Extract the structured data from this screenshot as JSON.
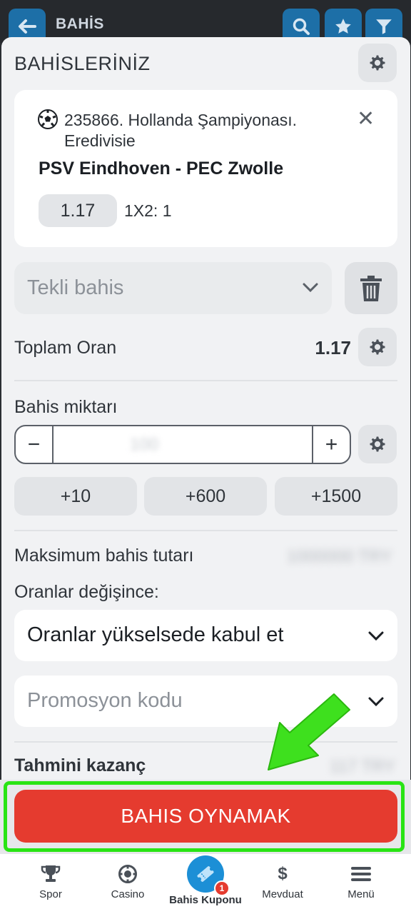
{
  "header": {
    "title": "BAHİS"
  },
  "sheet": {
    "title": "BAHİSLERİNİZ"
  },
  "bet": {
    "league": "235866. Hollanda Şampiyonası. Eredivisie",
    "match": "PSV Eindhoven - PEC Zwolle",
    "odd": "1.17",
    "market": "1X2: 1"
  },
  "bet_type": {
    "selected": "Tekli bahis"
  },
  "total_odds": {
    "label": "Toplam Oran",
    "value": "1.17"
  },
  "stake": {
    "label": "Bahis miktarı",
    "minus": "−",
    "plus": "+",
    "value": "100",
    "quick_amounts": [
      "+10",
      "+600",
      "+1500"
    ]
  },
  "max_bet": {
    "label": "Maksimum bahis tutarı",
    "value": "1000000 TRY"
  },
  "odds_change": {
    "label": "Oranlar değişince:",
    "selected": "Oranlar yükselsede kabul et"
  },
  "promo": {
    "placeholder": "Promosyon kodu"
  },
  "estimated_win": {
    "label": "Tahmini kazanç",
    "value": "117 TRY"
  },
  "play_button": {
    "label": "BAHIS OYNAMAK"
  },
  "nav": {
    "items": [
      {
        "label": "Spor",
        "icon": "trophy-icon"
      },
      {
        "label": "Casino",
        "icon": "casino-chip-icon"
      },
      {
        "label": "Bahis Kuponu",
        "icon": "ticket-icon",
        "badge": "1"
      },
      {
        "label": "Mevduat",
        "icon": "dollar-icon"
      },
      {
        "label": "Menü",
        "icon": "menu-icon"
      }
    ]
  },
  "colors": {
    "accent": "#1d6fa7",
    "play": "#e53b2f",
    "highlight": "#29e414",
    "arrow": "#3ee01e"
  }
}
